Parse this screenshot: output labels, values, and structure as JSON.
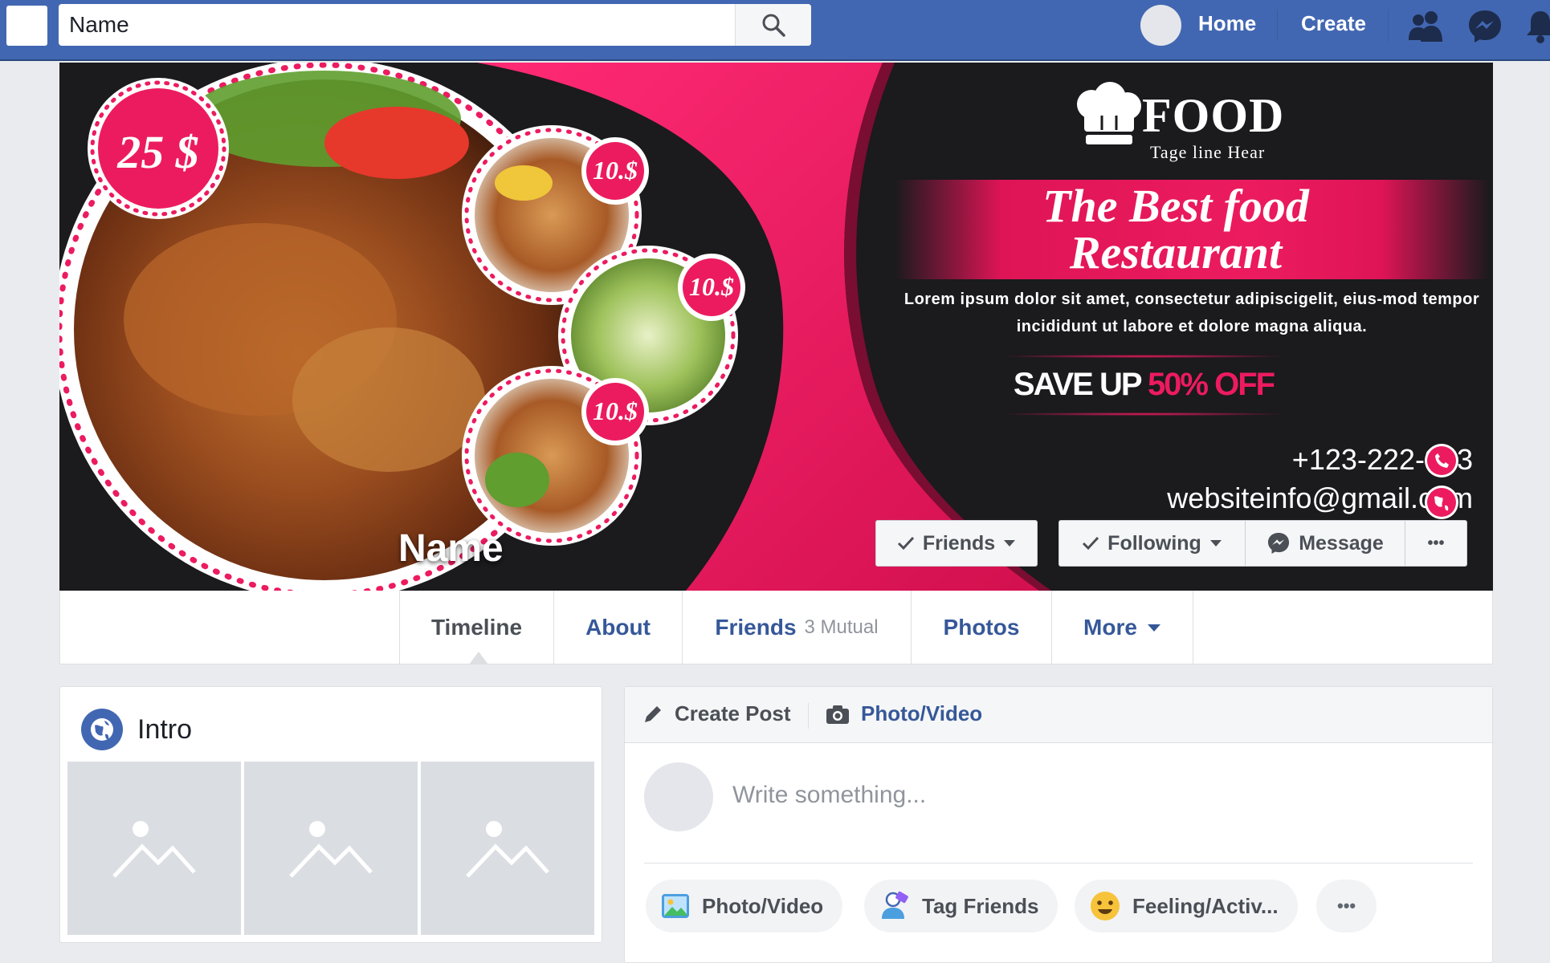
{
  "topbar": {
    "search_value": "Name",
    "links": [
      "Home",
      "Create"
    ],
    "icons": [
      "search-icon",
      "friends-icon",
      "messenger-icon",
      "notifications-icon"
    ],
    "bar_color": "#4267b2"
  },
  "cover": {
    "brand": "FOOD",
    "tagline": "Tage line Hear",
    "headline_1": "The Best food",
    "headline_2": "Restaurant",
    "description": "Lorem ipsum dolor sit amet, consectetur adipiscigelit,  eius-mod tempor incididunt ut labore et dolore magna aliqua.",
    "save_prefix": "SAVE UP ",
    "save_percent": "50% OFF",
    "phone": "+123-222-333",
    "email": "websiteinfo@gmail.com",
    "main_price": "25 $",
    "small_prices": [
      "10.$",
      "10.$",
      "10.$"
    ],
    "page_name": "Name",
    "accent_color": "#ec1b5f",
    "buttons": {
      "friends": "Friends",
      "following": "Following",
      "message": "Message",
      "more": "•••"
    }
  },
  "tabs": [
    {
      "label": "Timeline"
    },
    {
      "label": "About"
    },
    {
      "label": "Friends",
      "count": "3 Mutual"
    },
    {
      "label": "Photos"
    },
    {
      "label": "More"
    }
  ],
  "intro": {
    "title": "Intro",
    "photo_placeholders": 3
  },
  "composer": {
    "create_post": "Create Post",
    "photo_video": "Photo/Video",
    "placeholder": "Write something...",
    "actions": [
      "Photo/Video",
      "Tag Friends",
      "Feeling/Activ...",
      "•••"
    ]
  }
}
